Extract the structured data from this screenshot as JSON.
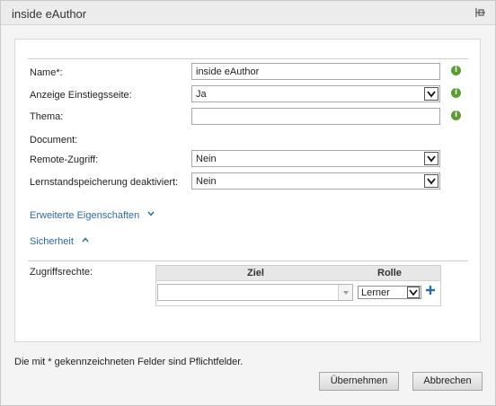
{
  "window": {
    "title": "inside eAuthor"
  },
  "form": {
    "name_label": "Name*:",
    "name_value": "inside eAuthor",
    "startpage_label": "Anzeige Einstiegsseite:",
    "startpage_value": "Ja",
    "theme_label": "Thema:",
    "theme_value": "",
    "document_label": "Document:",
    "remote_label": "Remote-Zugriff:",
    "remote_value": "Nein",
    "progress_label": "Lernstandspeicherung deaktiviert:",
    "progress_value": "Nein"
  },
  "sections": {
    "advanced_label": "Erweiterte Eigenschaften",
    "security_label": "Sicherheit"
  },
  "access": {
    "label": "Zugriffsrechte:",
    "col_target": "Ziel",
    "col_role": "Rolle",
    "target_value": "",
    "role_value": "Lerner"
  },
  "footer": {
    "required_note": "Die mit * gekennzeichneten Felder sind Pflichtfelder.",
    "apply_label": "Übernehmen",
    "cancel_label": "Abbrechen"
  },
  "colors": {
    "link": "#2a6ab0",
    "info": "#5a9e2f"
  }
}
